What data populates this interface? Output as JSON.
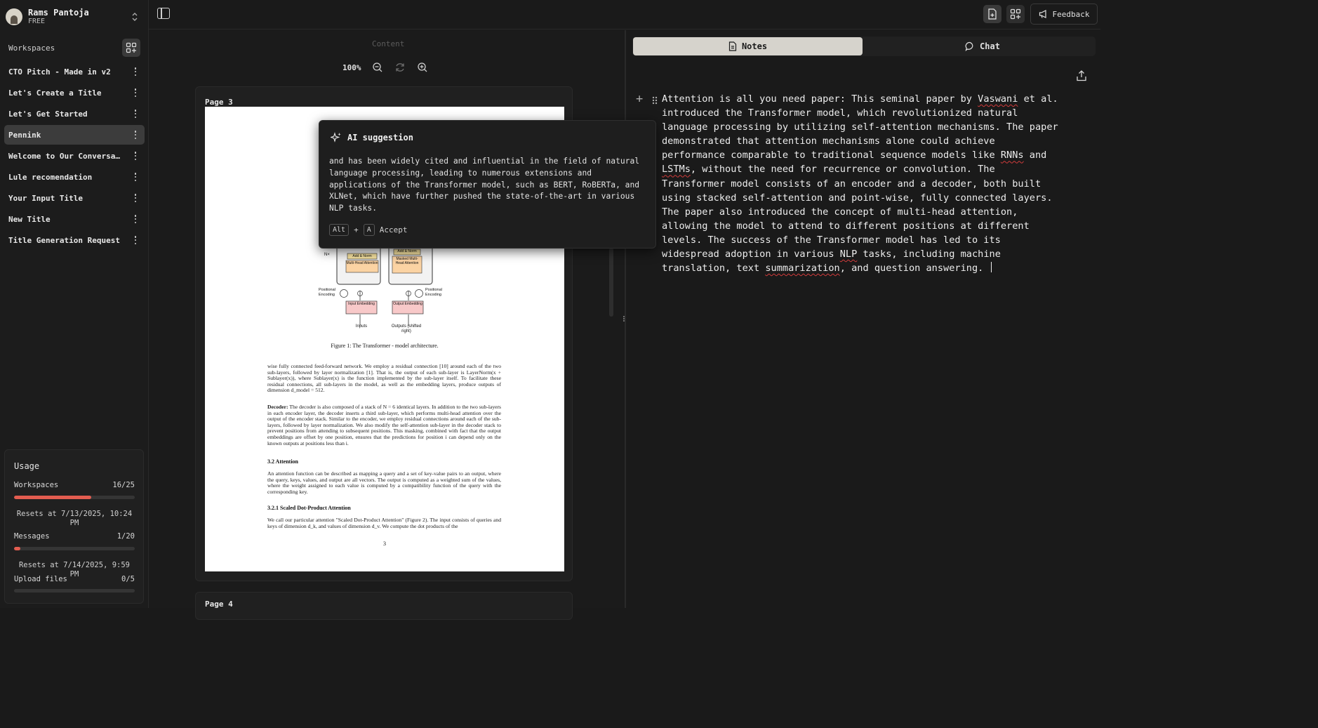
{
  "account": {
    "name": "Rams Pantoja",
    "plan": "FREE",
    "icons": [
      "avatar",
      "chevron-up-down-icon"
    ]
  },
  "sidebar": {
    "workspaces_label": "Workspaces",
    "add_workspace_icon": "add-grid-icon",
    "items": [
      {
        "label": "CTO Pitch - Made in v2",
        "active": false
      },
      {
        "label": "Let's Create a Title",
        "active": false
      },
      {
        "label": "Let's Get Started",
        "active": false
      },
      {
        "label": "Pennink",
        "active": true
      },
      {
        "label": "Welcome to Our Conversati…",
        "active": false
      },
      {
        "label": "Lule recomendation",
        "active": false
      },
      {
        "label": "Your Input Title",
        "active": false
      },
      {
        "label": "New Title",
        "active": false
      },
      {
        "label": "Title Generation Request",
        "active": false
      }
    ]
  },
  "usage": {
    "title": "Usage",
    "workspaces": {
      "label": "Workspaces",
      "count": "16/25",
      "fraction": 0.64,
      "reset": "Resets at 7/13/2025, 10:24 PM"
    },
    "messages": {
      "label": "Messages",
      "count": "1/20",
      "fraction": 0.05,
      "reset": "Resets at 7/14/2025, 9:59 PM"
    },
    "uploads": {
      "label": "Upload files",
      "count": "0/5",
      "fraction": 0
    }
  },
  "topbar": {
    "feedback_label": "Feedback",
    "icons": [
      "sidebar-toggle-icon",
      "new-document-icon",
      "add-grid-icon",
      "megaphone-icon"
    ]
  },
  "content": {
    "label": "Content",
    "zoom": "100%",
    "page3_label": "Page 3",
    "page4_label": "Page 4",
    "paper": {
      "diagram": {
        "nx": "N×",
        "add_norm_1": "Add & Norm",
        "mha": "Multi-Head Attention",
        "add_norm_2": "Add & Norm",
        "masked_mha": "Masked Multi-Head Attention",
        "pos_enc_left": "Positional Encoding",
        "pos_enc_right": "Positional Encoding",
        "input_emb": "Input Embedding",
        "output_emb": "Output Embedding",
        "inputs": "Inputs",
        "outputs": "Outputs (shifted right)"
      },
      "figure_caption": "Figure 1: The Transformer - model architecture.",
      "para1": "wise fully connected feed-forward network. We employ a residual connection [10] around each of the two sub-layers, followed by layer normalization [1]. That is, the output of each sub-layer is LayerNorm(x + Sublayer(x)), where Sublayer(x) is the function implemented by the sub-layer itself. To facilitate these residual connections, all sub-layers in the model, as well as the embedding layers, produce outputs of dimension d_model = 512.",
      "decoder_label": "Decoder:",
      "decoder_text": "The decoder is also composed of a stack of N = 6 identical layers. In addition to the two sub-layers in each encoder layer, the decoder inserts a third sub-layer, which performs multi-head attention over the output of the encoder stack. Similar to the encoder, we employ residual connections around each of the sub-layers, followed by layer normalization. We also modify the self-attention sub-layer in the decoder stack to prevent positions from attending to subsequent positions. This masking, combined with fact that the output embeddings are offset by one position, ensures that the predictions for position i can depend only on the known outputs at positions less than i.",
      "sec32": "3.2 Attention",
      "sec32_text": "An attention function can be described as mapping a query and a set of key-value pairs to an output, where the query, keys, values, and output are all vectors. The output is computed as a weighted sum of the values, where the weight assigned to each value is computed by a compatibility function of the query with the corresponding key.",
      "sec321": "3.2.1 Scaled Dot-Product Attention",
      "sec321_text": "We call our particular attention \"Scaled Dot-Product Attention\" (Figure 2). The input consists of queries and keys of dimension d_k, and values of dimension d_v. We compute the dot products of the",
      "page_number": "3"
    }
  },
  "ai_suggestion": {
    "title": "AI suggestion",
    "icon": "sparkles-icon",
    "text": "and has been widely cited and influential in the field of natural language processing, leading to numerous extensions and applications of the Transformer model, such as BERT, RoBERTa, and XLNet, which have further pushed the state-of-the-art in various NLP tasks.",
    "key1": "Alt",
    "plus": "+",
    "key2": "A",
    "accept": "Accept"
  },
  "right_panel": {
    "tabs": [
      {
        "label": "Notes",
        "icon": "document-icon",
        "active": true
      },
      {
        "label": "Chat",
        "icon": "chat-bubble-icon",
        "active": false
      }
    ],
    "export_icon": "share-upload-icon",
    "note_text": "Attention is all you need paper: This seminal paper by Vaswani et al. introduced the Transformer model, which revolutionized natural language processing by utilizing self-attention mechanisms. The paper demonstrated that attention mechanisms alone could achieve performance comparable to traditional sequence models like RNNs and LSTMs, without the need for recurrence or convolution. The Transformer model consists of an encoder and a decoder, both built using stacked self-attention and point-wise, fully connected layers. The paper also introduced the concept of multi-head attention, allowing the model to attend to different positions at different levels. The success of the Transformer model has led to its widespread adoption in various NLP tasks, including machine translation, text summarization, and question answering. "
  },
  "colors": {
    "accent_usage": "#e35d50",
    "notes_tab_bg": "#d6d3cc",
    "spellcheck": "#d23b3b"
  }
}
